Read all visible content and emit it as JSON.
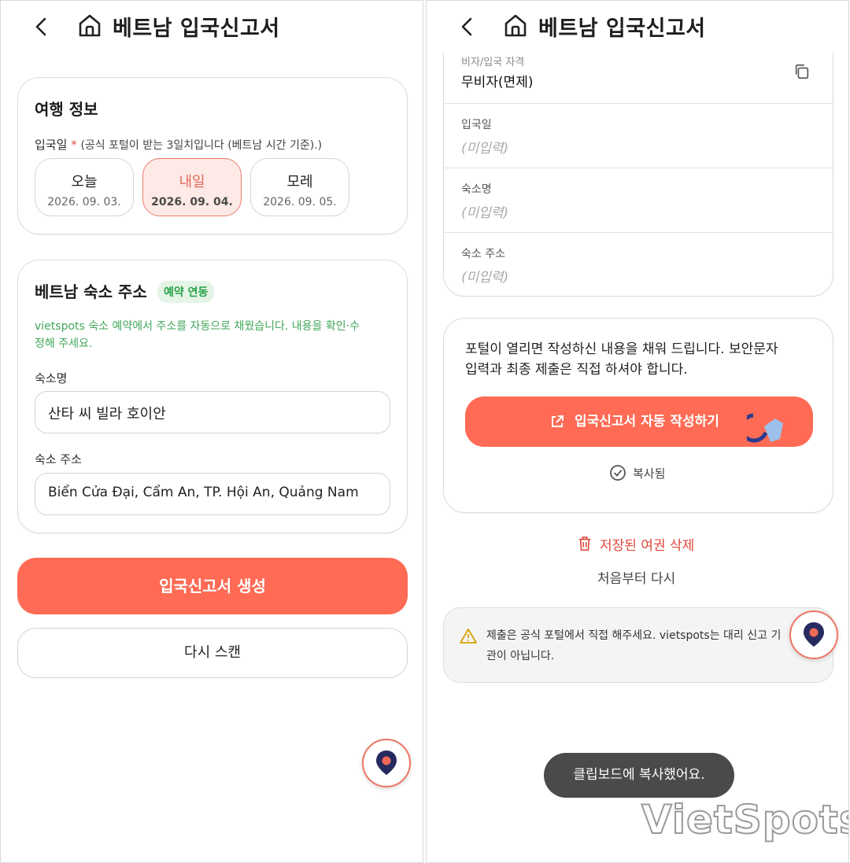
{
  "left": {
    "header": {
      "title": "베트남 입국신고서"
    },
    "travel": {
      "title": "여행 정보",
      "entry_label": "입국일",
      "entry_required": "*",
      "entry_hint": "(공식 포털이 받는 3일치입니다 (베트남 시간 기준).)",
      "dates": [
        {
          "label": "오늘",
          "date": "2026. 09. 03.",
          "selected": false
        },
        {
          "label": "내일",
          "date": "2026. 09. 04.",
          "selected": true
        },
        {
          "label": "모레",
          "date": "2026. 09. 05.",
          "selected": false
        }
      ]
    },
    "address": {
      "title": "베트남 숙소 주소",
      "badge": "예약 연동",
      "note_line1": "vietspots 숙소 예약에서 주소를 자동으로 채웠습니다. 내용을 확인·수",
      "note_line2": "정해 주세요.",
      "name_label": "숙소명",
      "name_value": "산타 씨 빌라 호이안",
      "addr_label": "숙소 주소",
      "addr_value": "Biển Cửa Đại, Cẩm An, TP. Hội An, Quảng Nam"
    },
    "generate_button": "입국신고서 생성",
    "rescan_button": "다시 스캔"
  },
  "right": {
    "header": {
      "title": "베트남 입국신고서"
    },
    "visa_label": "비자/입국 자격",
    "visa_value": "무비자(면제)",
    "fields": [
      {
        "label": "입국일",
        "value": "(미입력)"
      },
      {
        "label": "숙소명",
        "value": "(미입력)"
      },
      {
        "label": "숙소 주소",
        "value": "(미입력)"
      }
    ],
    "portal_info_line1": "포털이 열리면 작성하신 내용을 채워 드립니다. 보안문자",
    "portal_info_line2": "입력과 최종 제출은 직접 하셔야 합니다.",
    "autofill_button": "입국신고서 자동 작성하기",
    "copied_label": "복사됨",
    "delete_passport": "저장된 여권 삭제",
    "restart": "처음부터 다시",
    "warning_line1": "제출은 공식 포털에서 직접 해주세요. vietspots는 대리 신고 기",
    "warning_line2": "관이 아닙니다.",
    "toast": "클립보드에 복사했어요."
  },
  "watermark": "VietSpots",
  "colors": {
    "accent": "#ff6b55",
    "green": "#28a146",
    "danger": "#e0473d"
  }
}
